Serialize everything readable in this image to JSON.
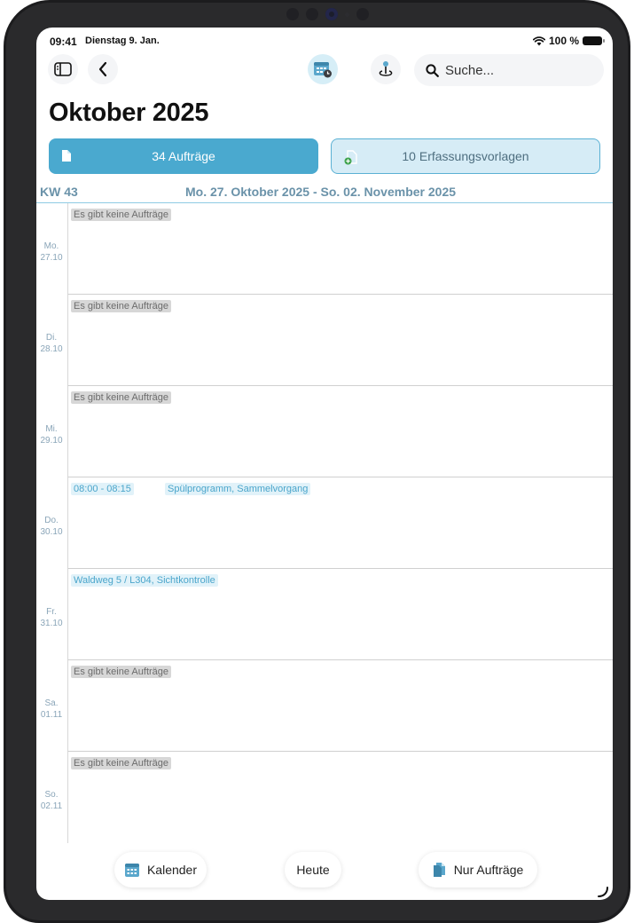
{
  "status": {
    "time": "09:41",
    "date": "Dienstag 9. Jan.",
    "battery": "100 %"
  },
  "nav": {
    "icons": [
      "sidebar-icon",
      "chevron-left-icon",
      "calendar-icon",
      "map-pin-icon",
      "search-icon"
    ],
    "search_placeholder": "Suche..."
  },
  "title": "Oktober 2025",
  "segments": {
    "orders": "34 Aufträge",
    "templates": "10 Erfassungsvorlagen"
  },
  "week": {
    "kw": "KW 43",
    "range": "Mo. 27. Oktober 2025 - So. 02. November 2025"
  },
  "days": [
    {
      "day": "Mo.",
      "date": "27.10",
      "entry": "Es gibt keine Aufträge"
    },
    {
      "day": "Di.",
      "date": "28.10",
      "entry": "Es gibt keine Aufträge"
    },
    {
      "day": "Mi.",
      "date": "29.10",
      "entry": "Es gibt keine Aufträge"
    },
    {
      "day": "Do.",
      "date": "30.10",
      "job_time": "08:00 - 08:15",
      "job_title": "Spülprogramm, Sammelvorgang"
    },
    {
      "day": "Fr.",
      "date": "31.10",
      "job_title": "Waldweg 5 / L304, Sichtkontrolle"
    },
    {
      "day": "Sa.",
      "date": "01.11",
      "entry": "Es gibt keine Aufträge"
    },
    {
      "day": "So.",
      "date": "02.11",
      "entry": "Es gibt keine Aufträge"
    }
  ],
  "toolbar": {
    "calendar": "Kalender",
    "today": "Heute",
    "orders_only": "Nur Aufträge"
  },
  "colors": {
    "accent": "#4aa9cf",
    "accent_light": "#d6ecf6",
    "empty_chip": "#d7d7d7",
    "job_chip": "#e1f2f9"
  }
}
